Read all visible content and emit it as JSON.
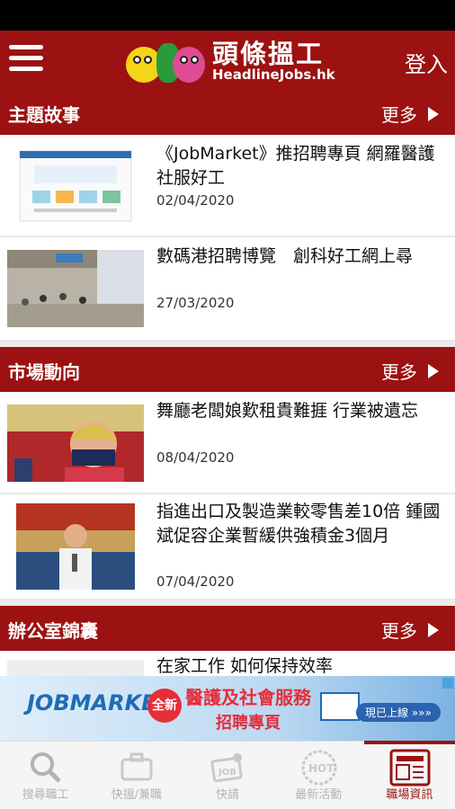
{
  "app": {
    "logo_zh": "頭條搵工",
    "logo_en": "HeadlineJobs.hk",
    "login": "登入"
  },
  "sections": [
    {
      "title": "主題故事",
      "more": "更多",
      "articles": [
        {
          "title": "《JobMarket》推招聘專頁 網羅醫護社服好工",
          "date": "02/04/2020"
        },
        {
          "title": "數碼港招聘博覽　創科好工網上尋",
          "date": "27/03/2020"
        }
      ]
    },
    {
      "title": "市場動向",
      "more": "更多",
      "articles": [
        {
          "title": "舞廳老闆娘歎租貴難捱 行業被遺忘",
          "date": "08/04/2020"
        },
        {
          "title": "指進出口及製造業較零售差10倍 鍾國斌促容企業暫緩供強積金3個月",
          "date": "07/04/2020"
        }
      ]
    },
    {
      "title": "辦公室錦囊",
      "more": "更多",
      "articles": [
        {
          "title": "在家工作 如何保持效率"
        }
      ]
    }
  ],
  "banner": {
    "brand": "JOBMARKET",
    "badge": "全新",
    "headline": "醫護及社會服務",
    "subline": "招聘專頁",
    "cta": "現已上線 »»»"
  },
  "tabs": [
    {
      "label": "搜尋職工",
      "icon": "search-icon",
      "active": false
    },
    {
      "label": "快搵/兼職",
      "icon": "briefcase-icon",
      "active": false
    },
    {
      "label": "快請",
      "icon": "job-pin-icon",
      "active": false
    },
    {
      "label": "最新活動",
      "icon": "hot-icon",
      "active": false
    },
    {
      "label": "職場資訊",
      "icon": "news-icon",
      "active": true
    }
  ],
  "colors": {
    "brand": "#9c1111",
    "tab_inactive": "#b3b3b3"
  }
}
